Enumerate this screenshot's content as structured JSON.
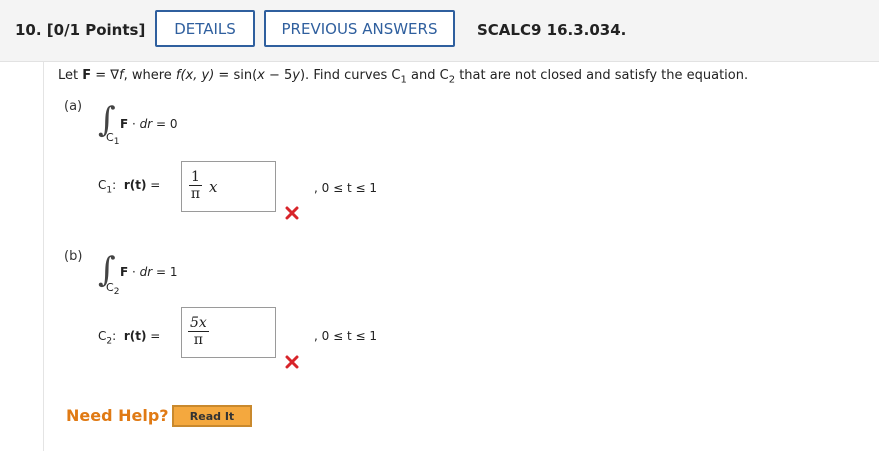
{
  "header": {
    "question_label": "10. [0/1 Points]",
    "details_button": "DETAILS",
    "previous_answers_button": "PREVIOUS ANSWERS",
    "assignment_code": "SCALC9 16.3.034."
  },
  "problem": {
    "prefix": "Let ",
    "F": "F",
    "eq_grad": " = ∇",
    "f": "f",
    "where": ", where ",
    "fxy": "f(x, y)",
    "eq": " = sin(",
    "x": "x",
    "minus": " − 5",
    "y": "y",
    "close": "). Find curves ",
    "C": "C",
    "sub1": "1",
    "and": " and ",
    "sub2": "2",
    "tail": " that are not closed and satisfy the equation."
  },
  "part_a": {
    "label": "(a)",
    "integral_sub": "C",
    "integral_sub_index": "1",
    "integrand_F": "F",
    "integrand_dot": " · ",
    "integrand_dr": "dr",
    "integrand_eq": " = 0",
    "curve_label": "C",
    "curve_index": "1",
    "colon": ":",
    "r_label": "r(t)",
    "equals": " =",
    "answer_num": "1",
    "answer_den": "π",
    "answer_var": "x",
    "range": ",   0 ≤ t ≤ 1",
    "status": "incorrect"
  },
  "part_b": {
    "label": "(b)",
    "integral_sub": "C",
    "integral_sub_index": "2",
    "integrand_F": "F",
    "integrand_dot": " · ",
    "integrand_dr": "dr",
    "integrand_eq": " = 1",
    "curve_label": "C",
    "curve_index": "2",
    "colon": ":",
    "r_label": "r(t)",
    "equals": " =",
    "answer_num": "5x",
    "answer_den": "π",
    "range": ",   0 ≤ t ≤ 1",
    "status": "incorrect"
  },
  "help": {
    "label": "Need Help?",
    "read_it_button": "Read It"
  },
  "colors": {
    "accent": "#2f5f9e",
    "incorrect": "#d8242a",
    "help": "#e07a14",
    "read_it": "#f4a83e"
  },
  "icons": {
    "incorrect_mark": "x-mark-icon",
    "integral": "integral-symbol"
  }
}
